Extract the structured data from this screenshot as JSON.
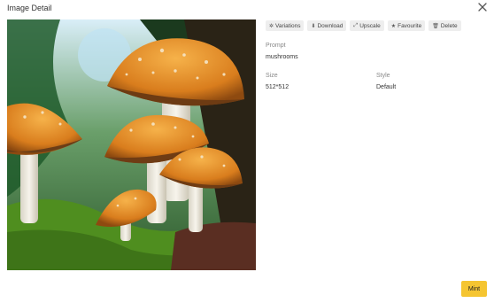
{
  "dialog": {
    "title": "Image Detail",
    "close_icon": "close-icon"
  },
  "actions": [
    {
      "label": "Variations",
      "icon": "variations-icon",
      "glyph": "✲"
    },
    {
      "label": "Download",
      "icon": "download-icon",
      "glyph": "⬇"
    },
    {
      "label": "Upscale",
      "icon": "upscale-icon",
      "glyph": "⤢"
    },
    {
      "label": "Favourite",
      "icon": "star-icon",
      "glyph": "★"
    },
    {
      "label": "Delete",
      "icon": "trash-icon",
      "glyph": "🗑"
    }
  ],
  "details": {
    "prompt_label": "Prompt",
    "prompt_value": "mushrooms",
    "size_label": "Size",
    "size_value": "512*512",
    "style_label": "Style",
    "style_value": "Default"
  },
  "footer": {
    "mint_label": "Mint",
    "accent": "#f5c531"
  },
  "image": {
    "subject": "mushrooms"
  }
}
